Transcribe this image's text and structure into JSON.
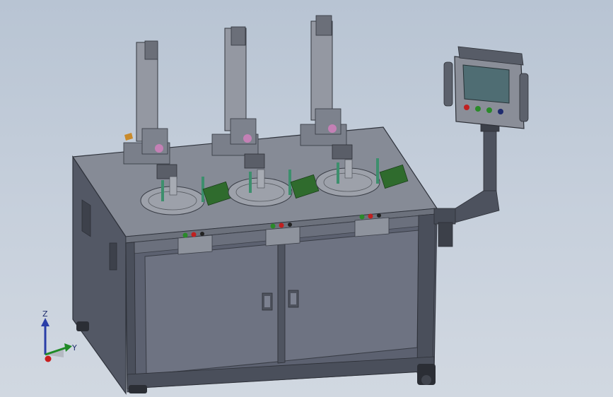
{
  "triad": {
    "z_label": "Z",
    "y_label": "Y",
    "colors": {
      "z": "#2a3ea8",
      "y": "#1f8a26",
      "x": "#c81e1e"
    }
  },
  "scene": {
    "object": "three-station-test-machine",
    "stations": [
      {
        "id": "station-1"
      },
      {
        "id": "station-2"
      },
      {
        "id": "station-3"
      }
    ],
    "hmi_buttons": [
      "red",
      "green",
      "green",
      "navy"
    ],
    "colors": {
      "frame": "#5f6573",
      "frame_dark": "#454b57",
      "top_plate": "#8a8f99",
      "screen": "#4f6d73",
      "green_board": "#2f6b2d",
      "rod_green": "#3d8f6d",
      "accent_red": "#c02020",
      "accent_orange": "#c98a2b"
    }
  }
}
